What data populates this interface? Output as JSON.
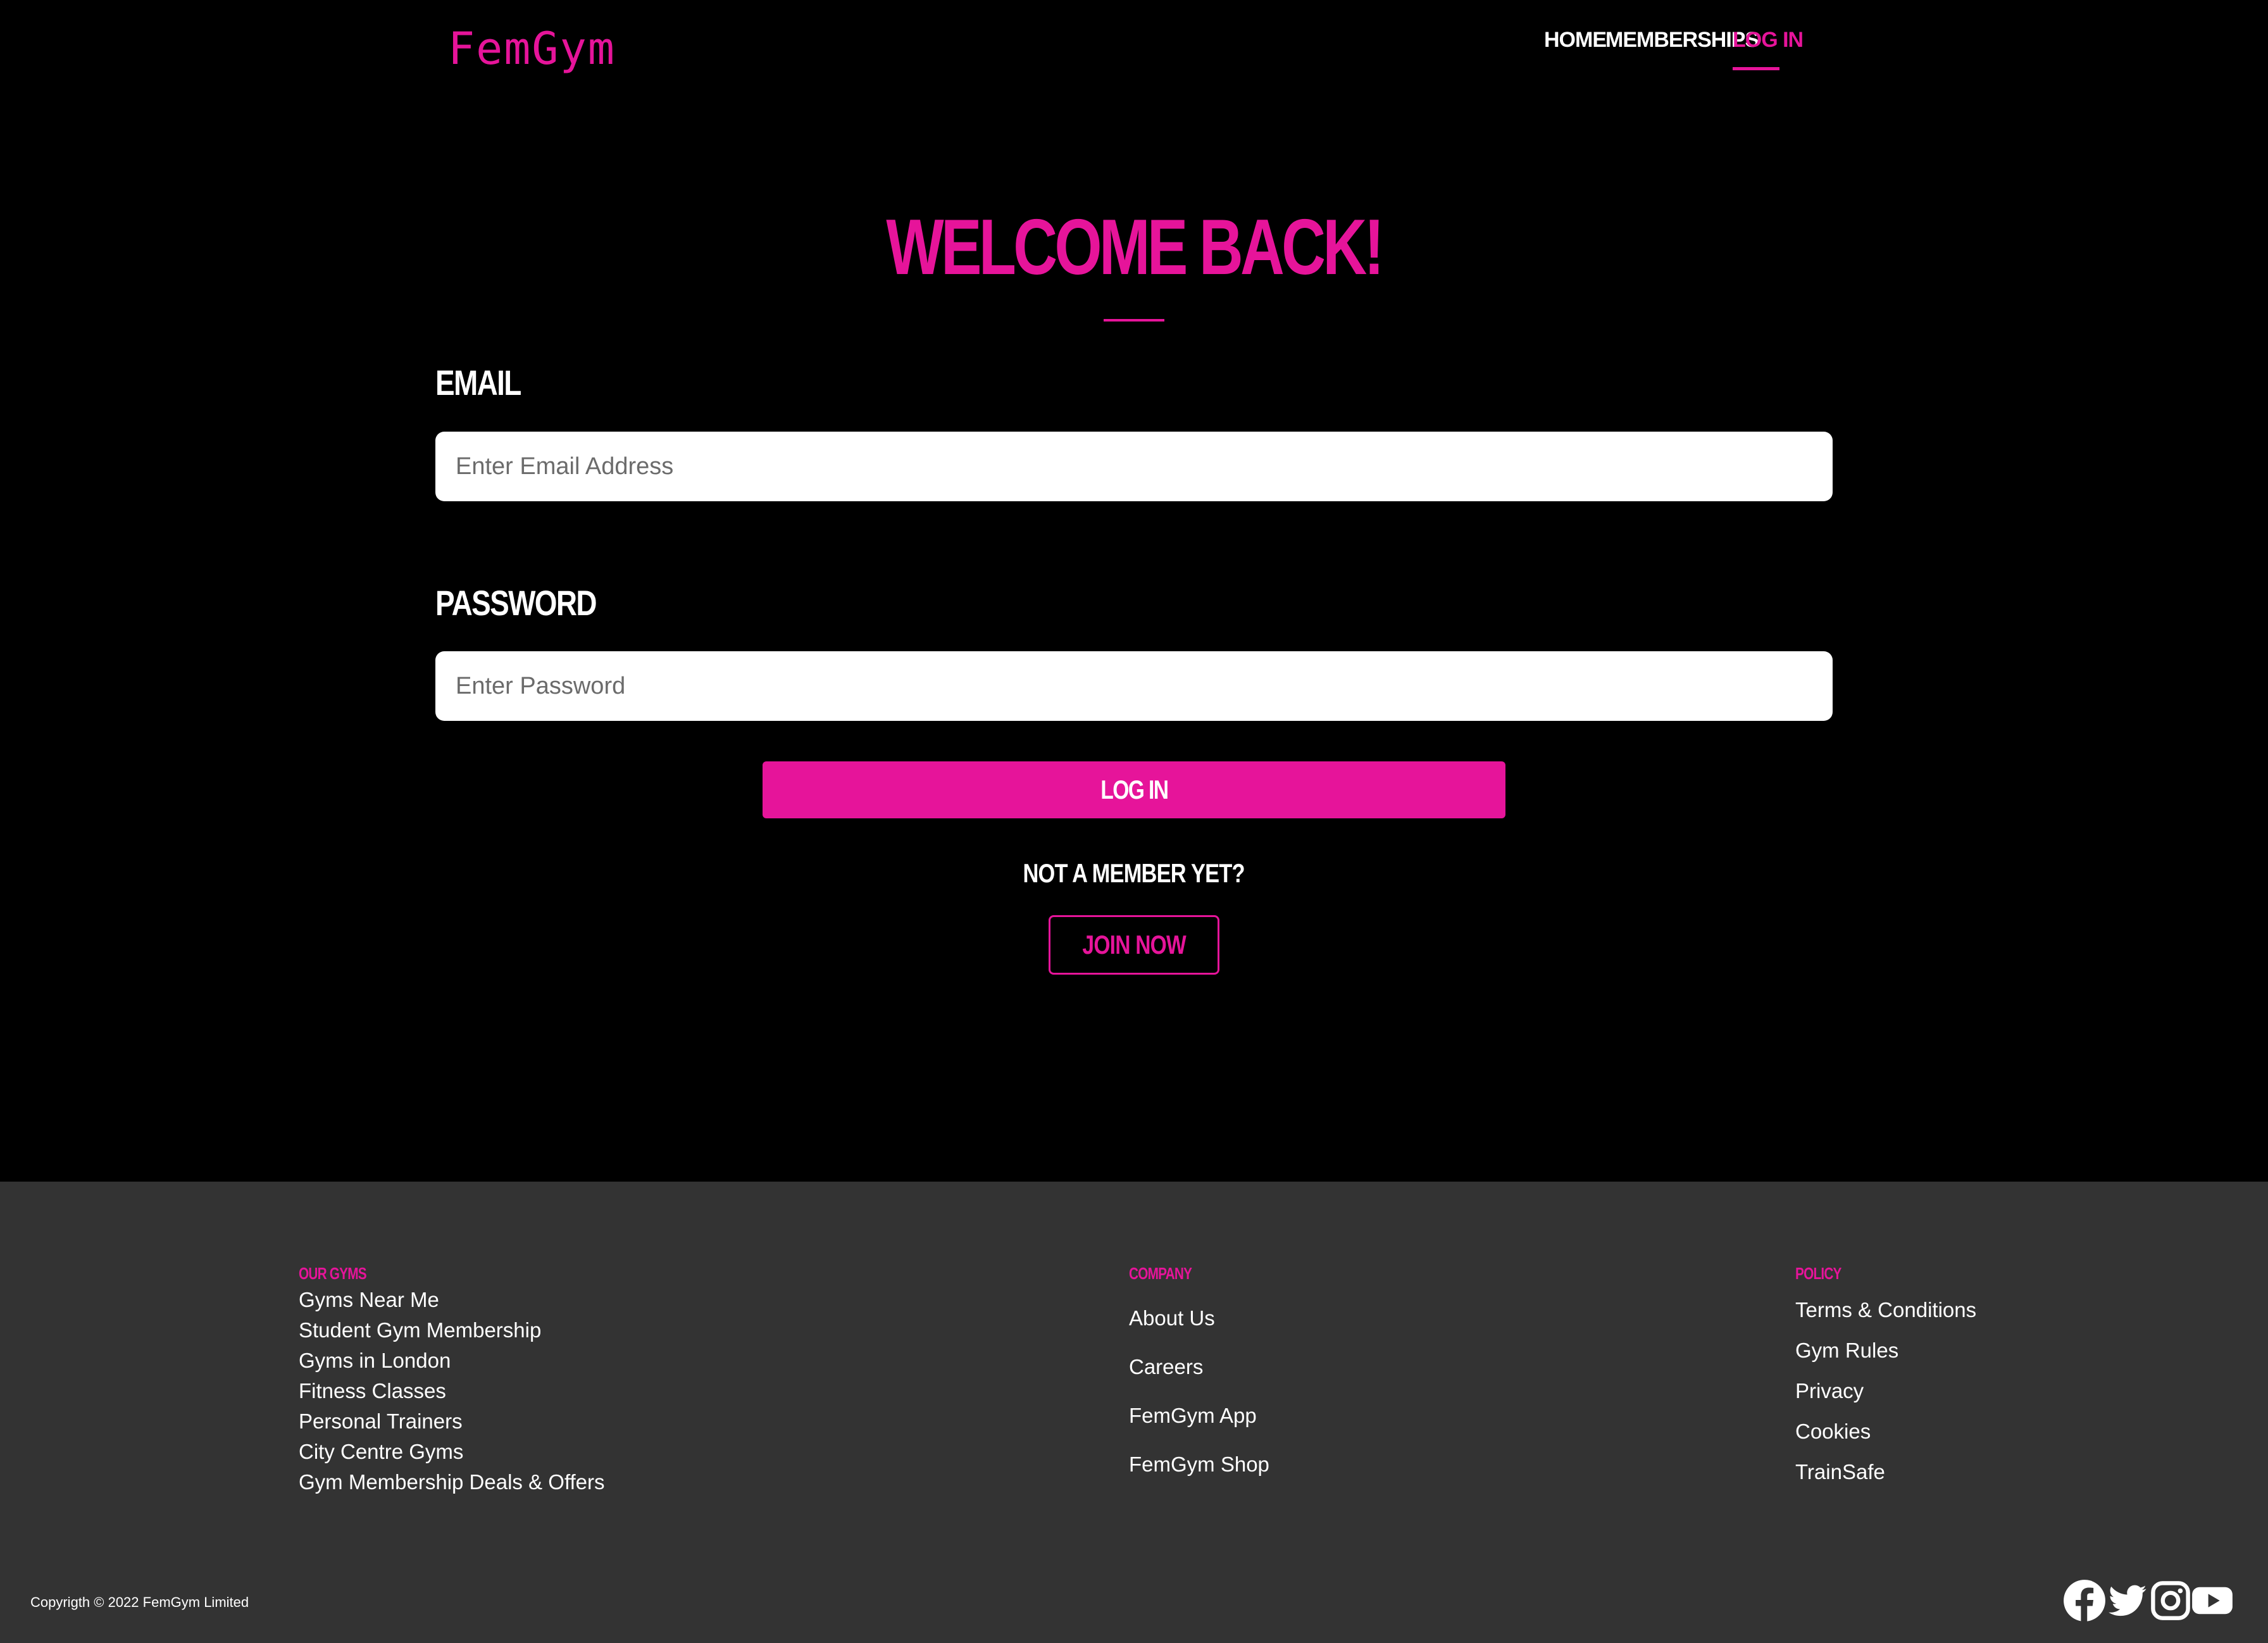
{
  "brand": {
    "logo": "FemGym",
    "accent_color": "#e6149a"
  },
  "nav": {
    "items": [
      {
        "label": "HOME",
        "active": false
      },
      {
        "label": "MEMBERSHIPS",
        "active": false
      },
      {
        "label": "LOG IN",
        "active": true
      }
    ]
  },
  "login": {
    "heading": "WELCOME BACK!",
    "email_label": "EMAIL",
    "email_placeholder": "Enter Email Address",
    "email_value": "",
    "password_label": "PASSWORD",
    "password_placeholder": "Enter Password",
    "password_value": "",
    "submit_label": "LOG IN",
    "not_member_text": "NOT A MEMBER YET?",
    "join_label": "JOIN NOW"
  },
  "footer": {
    "columns": [
      {
        "heading": "OUR GYMS",
        "links": [
          "Gyms Near Me",
          "Student Gym Membership",
          "Gyms in London",
          "Fitness Classes",
          "Personal Trainers",
          "City Centre Gyms",
          "Gym Membership Deals & Offers"
        ]
      },
      {
        "heading": "COMPANY",
        "links": [
          "About Us",
          "Careers",
          "FemGym App",
          "FemGym Shop"
        ]
      },
      {
        "heading": "POLICY",
        "links": [
          "Terms & Conditions",
          "Gym Rules",
          "Privacy",
          "Cookies",
          "TrainSafe"
        ]
      }
    ],
    "copyright": "Copyrigth © 2022 FemGym Limited",
    "social_icons": [
      "facebook-icon",
      "twitter-icon",
      "instagram-icon",
      "youtube-icon"
    ],
    "background_color": "#333333"
  }
}
